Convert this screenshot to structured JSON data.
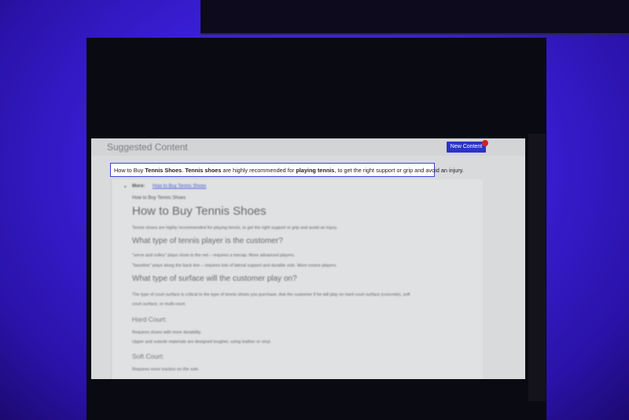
{
  "panel": {
    "title": "Suggested Content",
    "new_button_label": "New Content"
  },
  "highlight": {
    "segments": [
      {
        "text": "How to Buy ",
        "bold": false
      },
      {
        "text": "Tennis Shoes",
        "bold": true
      },
      {
        "text": ". ",
        "bold": false
      },
      {
        "text": "Tennis shoes",
        "bold": true
      },
      {
        "text": " are highly recommended for ",
        "bold": false
      },
      {
        "text": "playing tennis",
        "bold": true
      },
      {
        "text": ", to get the right support or grip and avoid an injury.",
        "bold": false
      }
    ]
  },
  "article": {
    "more_label": "More:",
    "more_link": "How to Buy Tennis Shoes",
    "breadcrumb": "How to Buy Tennis Shoes",
    "title": "How to Buy Tennis Shoes",
    "intro": "Tennis shoes are highly recommended for playing tennis, to get the right support or grip and avoid an injury.",
    "section1_heading": "What type of tennis player is the customer?",
    "section1_lines": [
      "\"serve and volley\" plays close to the net – requires a toecap. More advanced players.",
      "\"baseline\" plays along the back line – requires lots of lateral support and durable sole. More novice players."
    ],
    "section2_heading": "What type of surface will the customer play on?",
    "section2_lines": [
      "The type of court surface is critical to the type of tennis shoes you purchase. Ask the customer if he will play on hard court surface (concrete), soft",
      "court surface, or multi-court."
    ],
    "hard_heading": "Hard Court:",
    "hard_lines": [
      "Requires shoes with more durability.",
      "Upper and outsole materials are designed tougher, using leather or vinyl."
    ],
    "soft_heading": "Soft Court:",
    "soft_lines": [
      "Requires more traction on the sole."
    ]
  }
}
